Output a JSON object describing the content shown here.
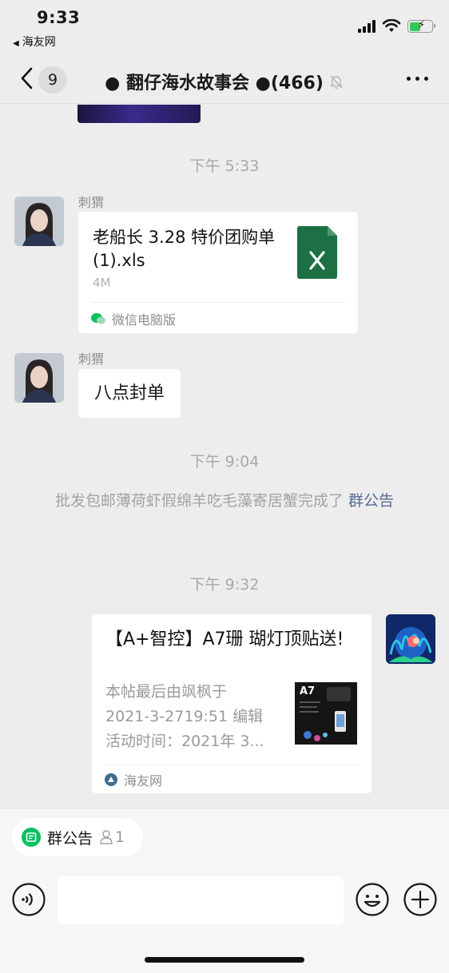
{
  "status_bar": {
    "time": "9:33",
    "back_app": "海友网",
    "signal_bars": 4,
    "battery_level": 0.5,
    "icons": [
      "signal-icon",
      "wifi-icon",
      "battery-charging-icon"
    ]
  },
  "nav": {
    "unread_count": "9",
    "title": "● 翻仔海水故事会 ●(466)",
    "icons": [
      "back-chevron-icon",
      "mute-bell-icon",
      "more-icon"
    ]
  },
  "messages": {
    "ts1": "下午 5:33",
    "sender1": "刺猬",
    "file": {
      "name": "老船长 3.28 特价团购单 (1).xls",
      "size": "4M",
      "source": "微信电脑版",
      "icon": "excel-file-icon"
    },
    "sender2": "刺猬",
    "text1": "八点封单",
    "ts2": "下午 9:04",
    "notice_text": "批发包邮薄荷虾假绵羊吃毛藻寄居蟹完成了 ",
    "notice_link": "群公告",
    "ts3": "下午 9:32",
    "link_card": {
      "title": "【A+智控】A7珊 瑚灯顶贴送!",
      "desc_line1": "本帖最后由飒枫于",
      "desc_line2": "2021-3-2719:51 编辑",
      "desc_line3": "活动时间：2021年 3...",
      "thumb_label": "A7",
      "source": "海友网"
    }
  },
  "bottom": {
    "chip_label": "群公告",
    "chip_count": "1",
    "input_value": "",
    "icons": [
      "voice-icon",
      "emoji-icon",
      "plus-icon"
    ]
  },
  "colors": {
    "background": "#ededed",
    "link": "#576b95",
    "excel_green": "#1d7044",
    "notice_green": "#07c160"
  }
}
